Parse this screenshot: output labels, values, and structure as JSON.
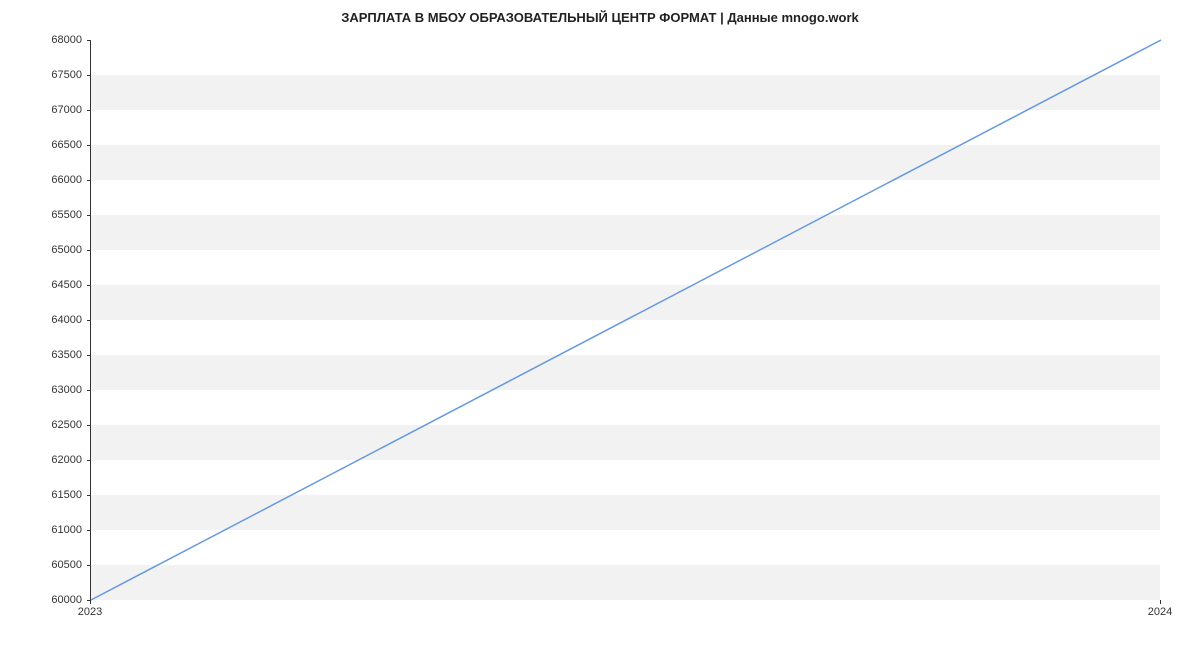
{
  "chart_data": {
    "type": "line",
    "title": "ЗАРПЛАТА В МБОУ ОБРАЗОВАТЕЛЬНЫЙ ЦЕНТР ФОРМАТ | Данные mnogo.work",
    "x": [
      2023,
      2024
    ],
    "values": [
      60000,
      68000
    ],
    "xlabel": "",
    "ylabel": "",
    "x_ticks": [
      2023,
      2024
    ],
    "y_ticks": [
      60000,
      60500,
      61000,
      61500,
      62000,
      62500,
      63000,
      63500,
      64000,
      64500,
      65000,
      65500,
      66000,
      66500,
      67000,
      67500,
      68000
    ],
    "xlim": [
      2023,
      2024
    ],
    "ylim": [
      60000,
      68000
    ],
    "line_color": "#6699dd",
    "grid": true
  }
}
